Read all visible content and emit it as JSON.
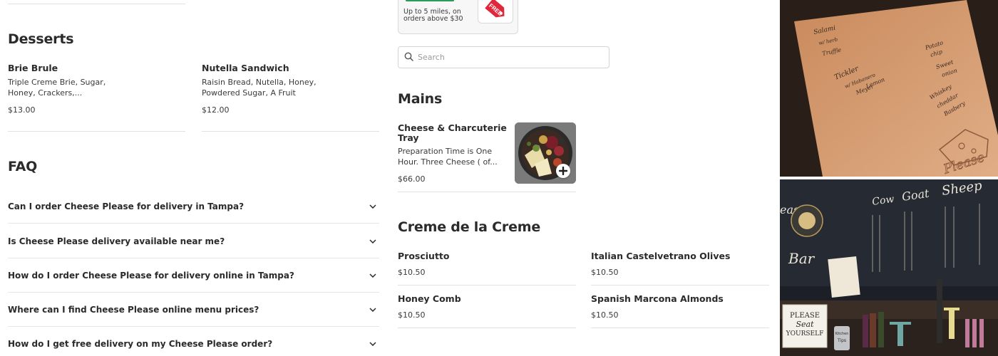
{
  "desserts": {
    "title": "Desserts",
    "items": [
      {
        "name": "Brie Brule",
        "desc_line1": "Triple Creme Brie, Sugar,",
        "desc_line2": "Honey, Crackers,...",
        "price": "$13.00"
      },
      {
        "name": "Nutella Sandwich",
        "desc_line1": "Raisin Bread, Nutella, Honey,",
        "desc_line2": "Powdered Sugar, A Fruit",
        "price": "$12.00"
      }
    ]
  },
  "faq": {
    "title": "FAQ",
    "questions": [
      "Can I order Cheese Please for delivery in Tampa?",
      "Is Cheese Please delivery available near me?",
      "How do I order Cheese Please for delivery online in Tampa?",
      "Where can I find Cheese Please online menu prices?",
      "How do I get free delivery on my Cheese Please order?"
    ]
  },
  "promo": {
    "line1": "Up to 5 miles, on",
    "line2": "orders above $30",
    "tag": "FREE"
  },
  "search": {
    "placeholder": "Search"
  },
  "mains": {
    "title": "Mains",
    "items": [
      {
        "name_line1": "Cheese & Charcuterie",
        "name_line2": "Tray",
        "desc_line1": "Preparation Time is One",
        "desc_line2": "Hour. Three Cheese ( of...",
        "price": "$66.00"
      }
    ]
  },
  "creme": {
    "title": "Creme de la Creme",
    "items": [
      {
        "name": "Prosciutto",
        "price": "$10.50"
      },
      {
        "name": "Italian Castelvetrano Olives",
        "price": "$10.50"
      },
      {
        "name": "Honey Comb",
        "price": "$10.50"
      },
      {
        "name": "Spanish Marcona Almonds",
        "price": "$10.50"
      }
    ]
  },
  "photos": {
    "top_notes": [
      "Salami",
      "w/ herb",
      "Truffle",
      "Potato",
      "chip",
      "Sweet",
      "onion",
      "Tickler",
      "w/ Habanero",
      "Meyer",
      "Lemon",
      "Whiskey",
      "cheddar",
      "Basbery",
      "Please"
    ],
    "bottom_signs": [
      "Cow",
      "Goat",
      "Sheep",
      "Bar",
      "PLEASE",
      "Seat",
      "YOURSELF",
      "Tips",
      "Kitchen"
    ]
  },
  "colors": {
    "accent_green": "#2a9d5c",
    "promo_red": "#e0283a",
    "text": "#2b2b2b",
    "divider": "#e1e1e1"
  }
}
